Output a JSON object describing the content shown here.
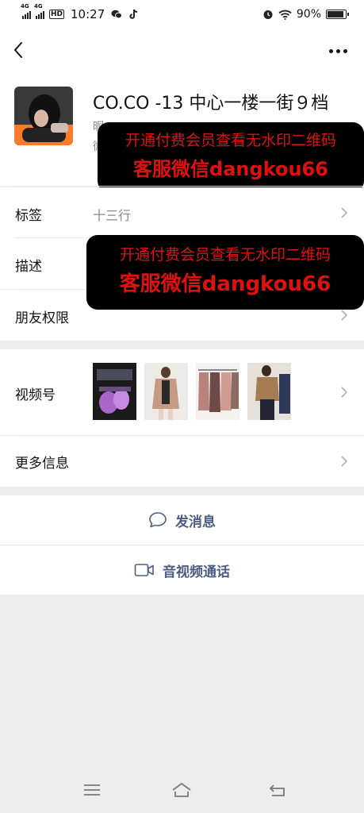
{
  "status_bar": {
    "network_1": "4G",
    "network_2": "4G",
    "hd_badge": "HD",
    "time": "10:27",
    "battery_text": "90%",
    "battery_level": 0.9
  },
  "profile": {
    "name": "CO.CO -13 中心一楼一街９档",
    "sub1_partial": "昵",
    "sub2_partial": "微"
  },
  "watermark": {
    "line1": "开通付费会员查看无水印二维码",
    "line2": "客服微信dangkou66"
  },
  "rows": {
    "tags": {
      "label": "标签",
      "value": "十三行"
    },
    "description": {
      "label": "描述"
    },
    "friend_perms": {
      "label": "朋友权限"
    },
    "channels": {
      "label": "视频号"
    },
    "more_info": {
      "label": "更多信息"
    }
  },
  "actions": {
    "send_message": "发消息",
    "av_call": "音视频通话"
  },
  "colors": {
    "link": "#4c5e82",
    "watermark_text": "#e01010",
    "background": "#ededed"
  }
}
